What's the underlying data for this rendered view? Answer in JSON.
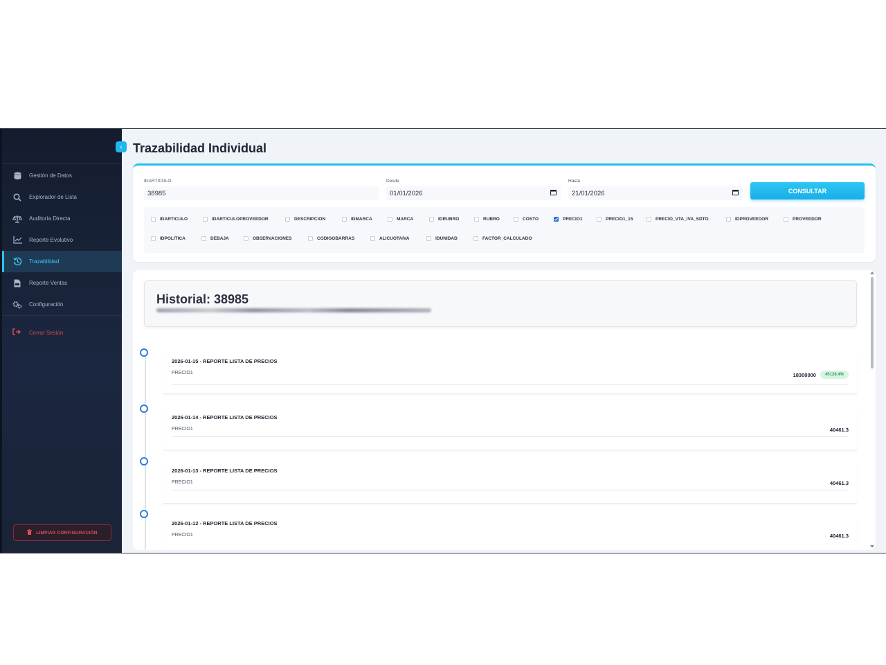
{
  "sidebar": {
    "items": [
      {
        "label": "Gestión de Datos",
        "icon": "database-icon"
      },
      {
        "label": "Explorador de Lista",
        "icon": "search-icon"
      },
      {
        "label": "Auditoría Directa",
        "icon": "scale-icon"
      },
      {
        "label": "Reporte Evolutivo",
        "icon": "line-chart-icon"
      },
      {
        "label": "Trazabilidad",
        "icon": "history-icon",
        "active": true
      },
      {
        "label": "Reporte Ventas",
        "icon": "file-invoice-icon"
      },
      {
        "label": "Configuración",
        "icon": "gears-icon"
      }
    ],
    "logout_label": "Cerrar Sesión",
    "clear_config_label": "LIMPIAR CONFIGURACIÓN"
  },
  "page": {
    "title": "Trazabilidad Individual"
  },
  "filters": {
    "idarticulo_label": "IDARTICULO",
    "idarticulo_value": "38985",
    "desde_label": "Desde",
    "desde_value": "01/01/2026",
    "hasta_label": "Hasta",
    "hasta_value": "21/01/2026",
    "consult_label": "CONSULTAR",
    "columns": [
      {
        "label": "IDARTICULO",
        "checked": false
      },
      {
        "label": "IDARTICULOPROVEEDOR",
        "checked": false
      },
      {
        "label": "DESCRIPCION",
        "checked": false
      },
      {
        "label": "IDMARCA",
        "checked": false
      },
      {
        "label": "MARCA",
        "checked": false
      },
      {
        "label": "IDRUBRO",
        "checked": false
      },
      {
        "label": "RUBRO",
        "checked": false
      },
      {
        "label": "COSTO",
        "checked": false
      },
      {
        "label": "PRECIO1",
        "checked": true
      },
      {
        "label": "PRECIO1_15",
        "checked": false
      },
      {
        "label": "PRECIO_VTA_IVA_SDTO",
        "checked": false
      },
      {
        "label": "IDPROVEEDOR",
        "checked": false
      },
      {
        "label": "PROVEEDOR",
        "checked": false
      },
      {
        "label": "IDPOLITICA",
        "checked": false
      },
      {
        "label": "DEBAJA",
        "checked": false
      },
      {
        "label": "OBSERVACIONES",
        "checked": false
      },
      {
        "label": "CODIGOBARRAS",
        "checked": false
      },
      {
        "label": "ALICUOTAIVA",
        "checked": false
      },
      {
        "label": "IDUNIDAD",
        "checked": false
      },
      {
        "label": "FACTOR_CALCULADO",
        "checked": false
      }
    ]
  },
  "history": {
    "title": "Historial: 38985",
    "entries": [
      {
        "title": "2026-01-15 - REPORTE LISTA DE PRECIOS",
        "field": "PRECIO1",
        "value": "18300000",
        "badge": "45128.4%"
      },
      {
        "title": "2026-01-14 - REPORTE LISTA DE PRECIOS",
        "field": "PRECIO1",
        "value": "40461.3"
      },
      {
        "title": "2026-01-13 - REPORTE LISTA DE PRECIOS",
        "field": "PRECIO1",
        "value": "40461.3"
      },
      {
        "title": "2026-01-12 - REPORTE LISTA DE PRECIOS",
        "field": "PRECIO1",
        "value": "40461.3"
      }
    ]
  },
  "colors": {
    "accent": "#22c0ee",
    "sidebar_bg": "#1b2740",
    "danger": "#d64550",
    "timeline_dot": "#2f7be0"
  }
}
